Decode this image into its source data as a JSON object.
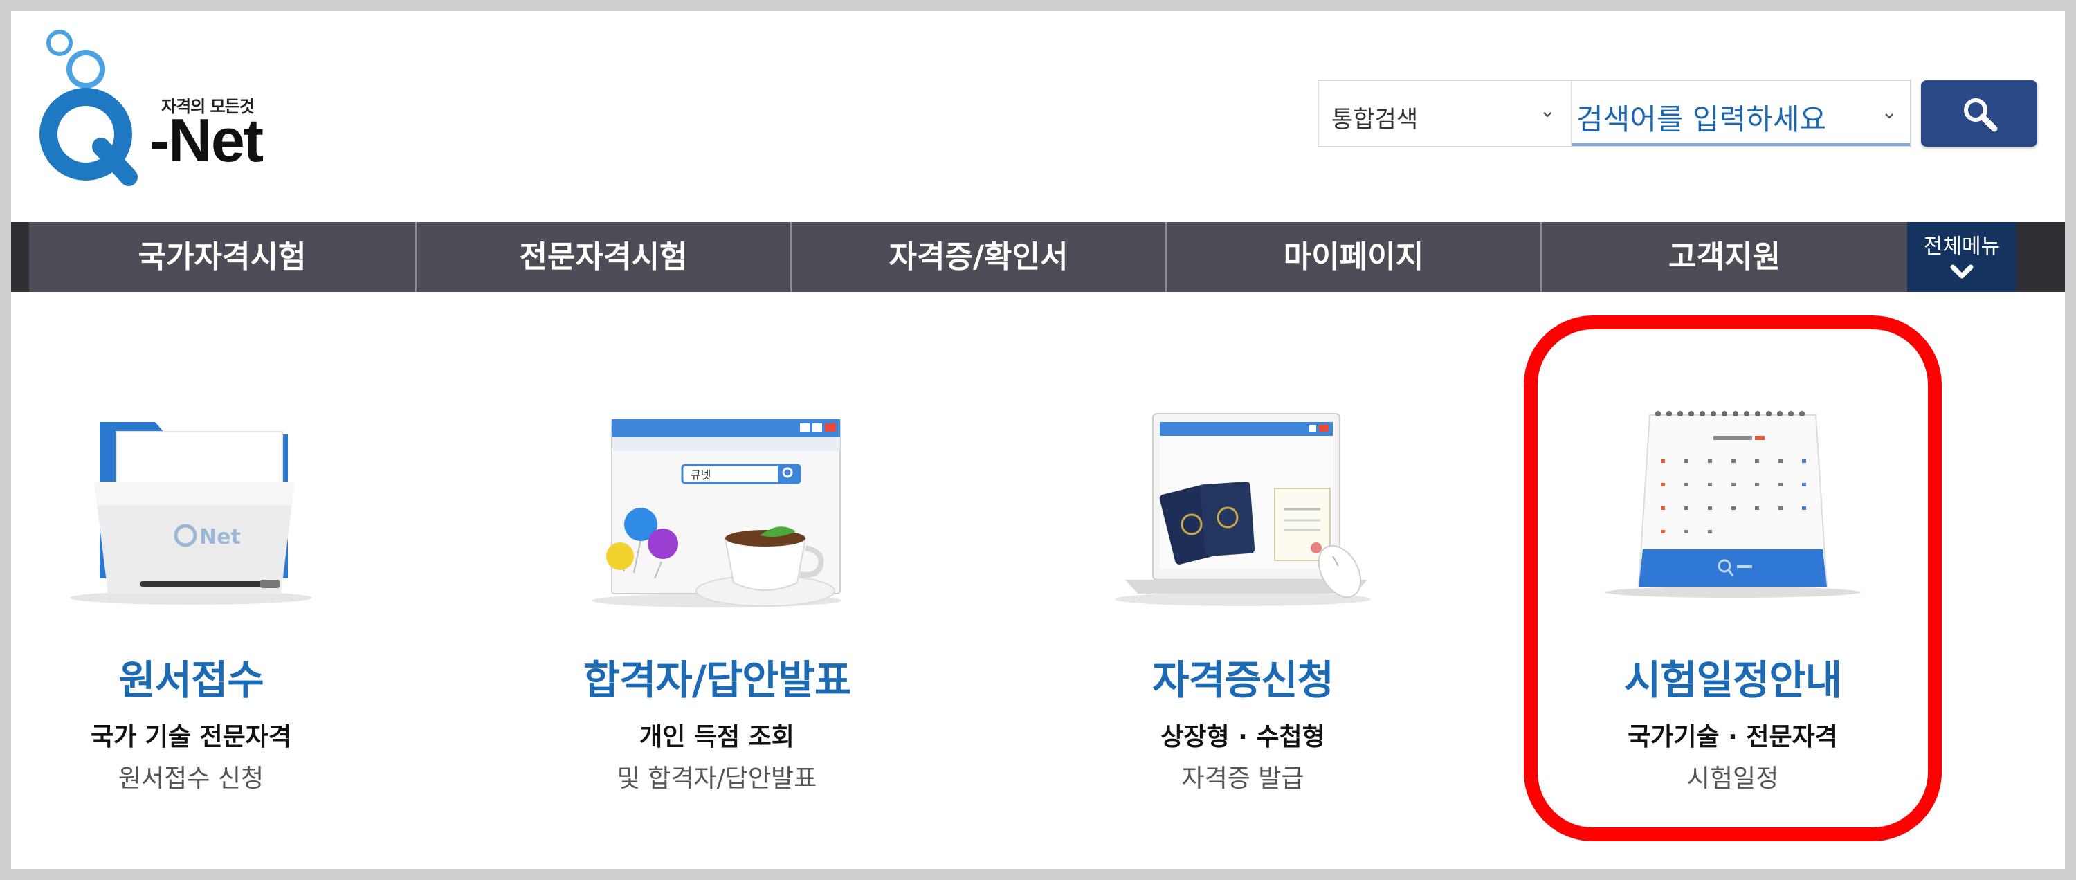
{
  "header": {
    "logo": {
      "tagline": "자격의 모든것",
      "brand": "-Net",
      "mark_letter": "Q"
    },
    "search": {
      "scope_label": "통합검색",
      "placeholder": "검색어를 입력하세요",
      "button_icon": "magnifier-icon"
    }
  },
  "nav": {
    "items": [
      {
        "label": "국가자격시험"
      },
      {
        "label": "전문자격시험"
      },
      {
        "label": "자격증/확인서"
      },
      {
        "label": "마이페이지"
      },
      {
        "label": "고객지원"
      }
    ],
    "all_menu_label": "전체메뉴",
    "all_menu_icon": "chevron-down-icon"
  },
  "cards": [
    {
      "title": "원서접수",
      "sub1": "국가 기술 전문자격",
      "sub2": "원서접수 신청",
      "icon": "folder-icon",
      "folder_logo": "Net"
    },
    {
      "title": "합격자/답안발표",
      "sub1": "개인 득점 조회",
      "sub2": "및 합격자/답안발표",
      "icon": "browser-coffee-icon",
      "browser_search_text": "큐넷"
    },
    {
      "title": "자격증신청",
      "sub1": "상장형 · 수첩형",
      "sub2": "자격증 발급",
      "icon": "laptop-passport-icon"
    },
    {
      "title": "시험일정안내",
      "sub1": "국가기술 · 전문자격",
      "sub2": "시험일정",
      "icon": "calendar-icon"
    }
  ],
  "highlight": {
    "target": "시험일정안내",
    "color": "#ff0000"
  },
  "colors": {
    "accent_blue": "#1c6ab3",
    "nav_bg": "#4d4d57",
    "search_button": "#294a86"
  }
}
